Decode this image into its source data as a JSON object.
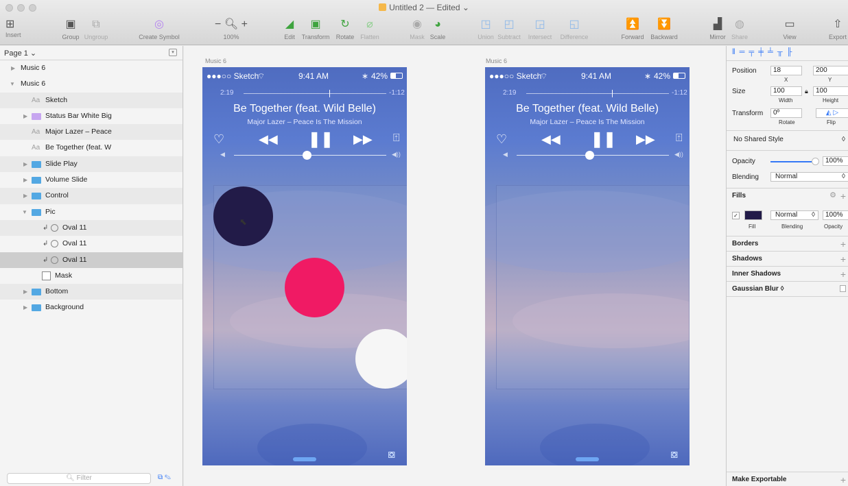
{
  "window": {
    "title": "Untitled 2",
    "status": "— Edited"
  },
  "toolbar": {
    "insert": "Insert",
    "group": "Group",
    "ungroup": "Ungroup",
    "create_symbol": "Create Symbol",
    "zoom": "100%",
    "edit": "Edit",
    "transform": "Transform",
    "rotate": "Rotate",
    "flatten": "Flatten",
    "mask": "Mask",
    "scale": "Scale",
    "union": "Union",
    "subtract": "Subtract",
    "intersect": "Intersect",
    "difference": "Difference",
    "forward": "Forward",
    "backward": "Backward",
    "mirror": "Mirror",
    "share": "Share",
    "view": "View",
    "export": "Export"
  },
  "layers": {
    "page": "Page 1 ⌄",
    "items": [
      {
        "label": "Music 6"
      },
      {
        "label": "Music 6"
      },
      {
        "label": "Sketch"
      },
      {
        "label": "Status Bar White Big"
      },
      {
        "label": "Major Lazer – Peace"
      },
      {
        "label": "Be Together (feat. W"
      },
      {
        "label": "Slide Play"
      },
      {
        "label": "Volume Slide"
      },
      {
        "label": "Control"
      },
      {
        "label": "Pic"
      },
      {
        "label": "Oval 11"
      },
      {
        "label": "Oval 11"
      },
      {
        "label": "Oval 11"
      },
      {
        "label": "Mask"
      },
      {
        "label": "Bottom"
      },
      {
        "label": "Background"
      }
    ],
    "filter_placeholder": "Filter"
  },
  "artboards": [
    {
      "label": "Music 6"
    },
    {
      "label": "Music 6"
    }
  ],
  "player": {
    "carrier": "●●●○○ Sketch",
    "clock": "9:41 AM",
    "battery": "42%",
    "elapsed": "2:19",
    "remaining": "-1:12",
    "song": "Be Together (feat. Wild Belle)",
    "artist": "Major Lazer – Peace Is The Mission",
    "progress_fraction": 0.6,
    "volume_fraction": 0.45
  },
  "colors": {
    "dark_circle": "#221b48",
    "pink_circle": "#f01a64",
    "white_circle": "#f6f6f6",
    "accent": "#3478f6"
  },
  "inspector": {
    "position_label": "Position",
    "x": "18",
    "y": "200",
    "x_sub": "X",
    "y_sub": "Y",
    "size_label": "Size",
    "width": "100",
    "height": "100",
    "width_sub": "Width",
    "height_sub": "Height",
    "transform_label": "Transform",
    "rotate": "0º",
    "rotate_sub": "Rotate",
    "flip_sub": "Flip",
    "shared_style": "No Shared Style",
    "opacity_label": "Opacity",
    "opacity": "100%",
    "blending_label": "Blending",
    "blending": "Normal",
    "fills": "Fills",
    "fill_sub": "Fill",
    "fill_blend": "Normal",
    "fill_blend_sub": "Blending",
    "fill_opacity": "100%",
    "fill_opacity_sub": "Opacity",
    "borders": "Borders",
    "shadows": "Shadows",
    "inner_shadows": "Inner Shadows",
    "gaussian_blur": "Gaussian Blur ◊",
    "make_exportable": "Make Exportable"
  }
}
